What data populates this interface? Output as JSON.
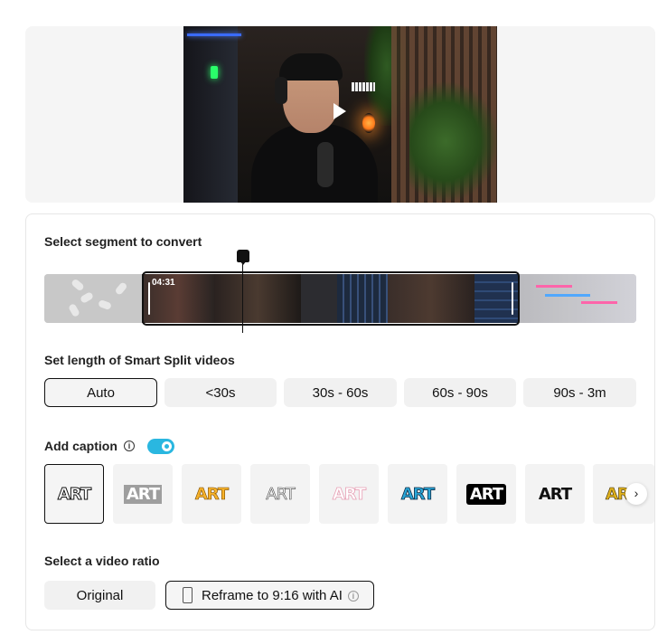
{
  "segment": {
    "title": "Select segment to convert",
    "time_label": "04:31"
  },
  "length": {
    "title": "Set length of Smart Split videos",
    "options": [
      "Auto",
      "<30s",
      "30s - 60s",
      "60s - 90s",
      "90s - 3m"
    ],
    "selected": "Auto"
  },
  "caption": {
    "title": "Add caption",
    "enabled": true,
    "styles": [
      "ART",
      "ART",
      "ART",
      "ART",
      "ART",
      "ART",
      "ART",
      "ART",
      "ART"
    ],
    "selected_index": 0
  },
  "ratio": {
    "title": "Select a video ratio",
    "original_label": "Original",
    "reframe_label": "Reframe to 9:16 with AI"
  },
  "colors": {
    "toggle_on": "#2ab7e0",
    "selected_border": "#111111"
  }
}
